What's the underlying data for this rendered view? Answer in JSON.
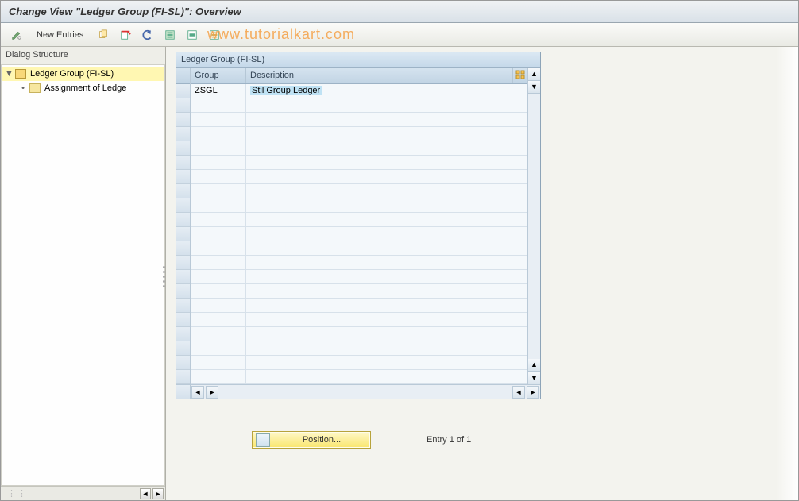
{
  "header": {
    "title": "Change View \"Ledger Group (FI-SL)\": Overview"
  },
  "toolbar": {
    "new_entries_label": "New Entries"
  },
  "watermark": "www.tutorialkart.com",
  "sidebar": {
    "title": "Dialog Structure",
    "items": [
      {
        "label": "Ledger Group (FI-SL)",
        "selected": true,
        "open": true
      },
      {
        "label": "Assignment of Ledge",
        "selected": false,
        "open": false
      }
    ]
  },
  "table": {
    "caption": "Ledger Group (FI-SL)",
    "columns": {
      "group": "Group",
      "description": "Description"
    },
    "rows": [
      {
        "group": "ZSGL",
        "description": "Stil Group Ledger"
      }
    ],
    "empty_row_count": 20
  },
  "footer": {
    "position_label": "Position...",
    "entry_status": "Entry 1 of 1"
  }
}
